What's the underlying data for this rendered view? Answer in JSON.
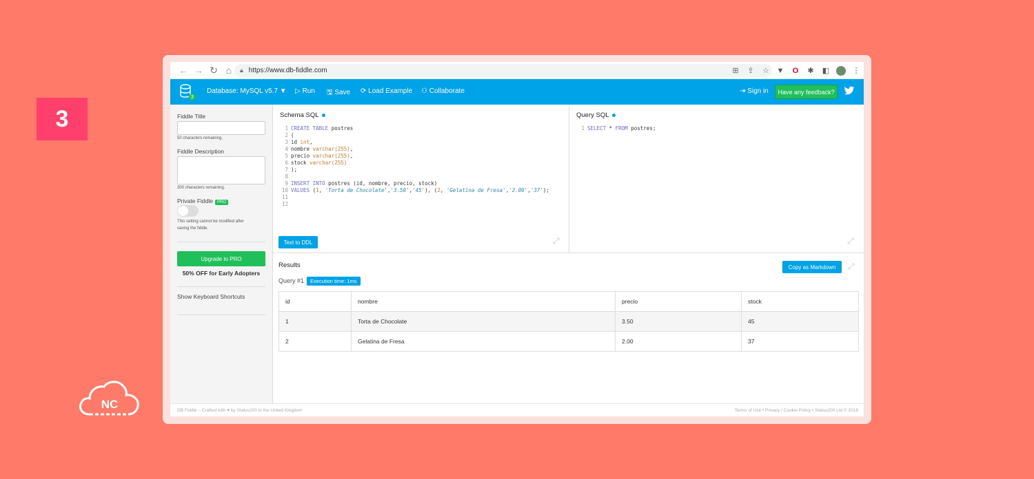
{
  "step_number": "3",
  "brand_mark": "NC",
  "browser": {
    "url": "https://www.db-fiddle.com",
    "back_icon": "arrow-left-icon",
    "forward_icon": "arrow-right-icon",
    "reload_icon": "reload-icon",
    "home_icon": "home-icon"
  },
  "appbar": {
    "logo_badge": "3",
    "database_label": "Database: MySQL v5.7 ▼",
    "run_label": "Run",
    "save_label": "Save",
    "load_example_label": "Load Example",
    "collaborate_label": "Collaborate",
    "sign_in_label": "Sign in",
    "feedback_label": "Have any feedback?",
    "accent": "#00a2e8",
    "green": "#1fbf5a"
  },
  "sidebar": {
    "fiddle_title_label": "Fiddle Title",
    "title_remaining": "50 characters remaining.",
    "fiddle_description_label": "Fiddle Description",
    "description_remaining": "300 characters remaining.",
    "private_label": "Private Fiddle",
    "pro_tag": "PRO",
    "private_note_1": "This setting cannot be modified after",
    "private_note_2": "saving the fiddle.",
    "upgrade_label": "Upgrade to PRO",
    "offer_text": "50% OFF for Early Adopters",
    "shortcuts_label": "Show Keyboard Shortcuts"
  },
  "schema": {
    "title": "Schema SQL",
    "text_to_ddl": "Text to DDL"
  },
  "query": {
    "title": "Query SQL"
  },
  "results": {
    "title": "Results",
    "copy_markdown": "Copy as Markdown",
    "query_label": "Query #1",
    "exec_time": "Execution time: 1ms",
    "headers": [
      "id",
      "nombre",
      "precio",
      "stock"
    ],
    "rows": [
      [
        "1",
        "Torta de Chocolate",
        "3.50",
        "45"
      ],
      [
        "2",
        "Gelatina de Fresa",
        "2.00",
        "37"
      ]
    ]
  },
  "footer": {
    "left": "DB Fiddle – Crafted with ♥ by Status200 in the United Kingdom",
    "right": "Terms of Use • Privacy / Cookie Policy • Status200 Ltd © 2018"
  }
}
